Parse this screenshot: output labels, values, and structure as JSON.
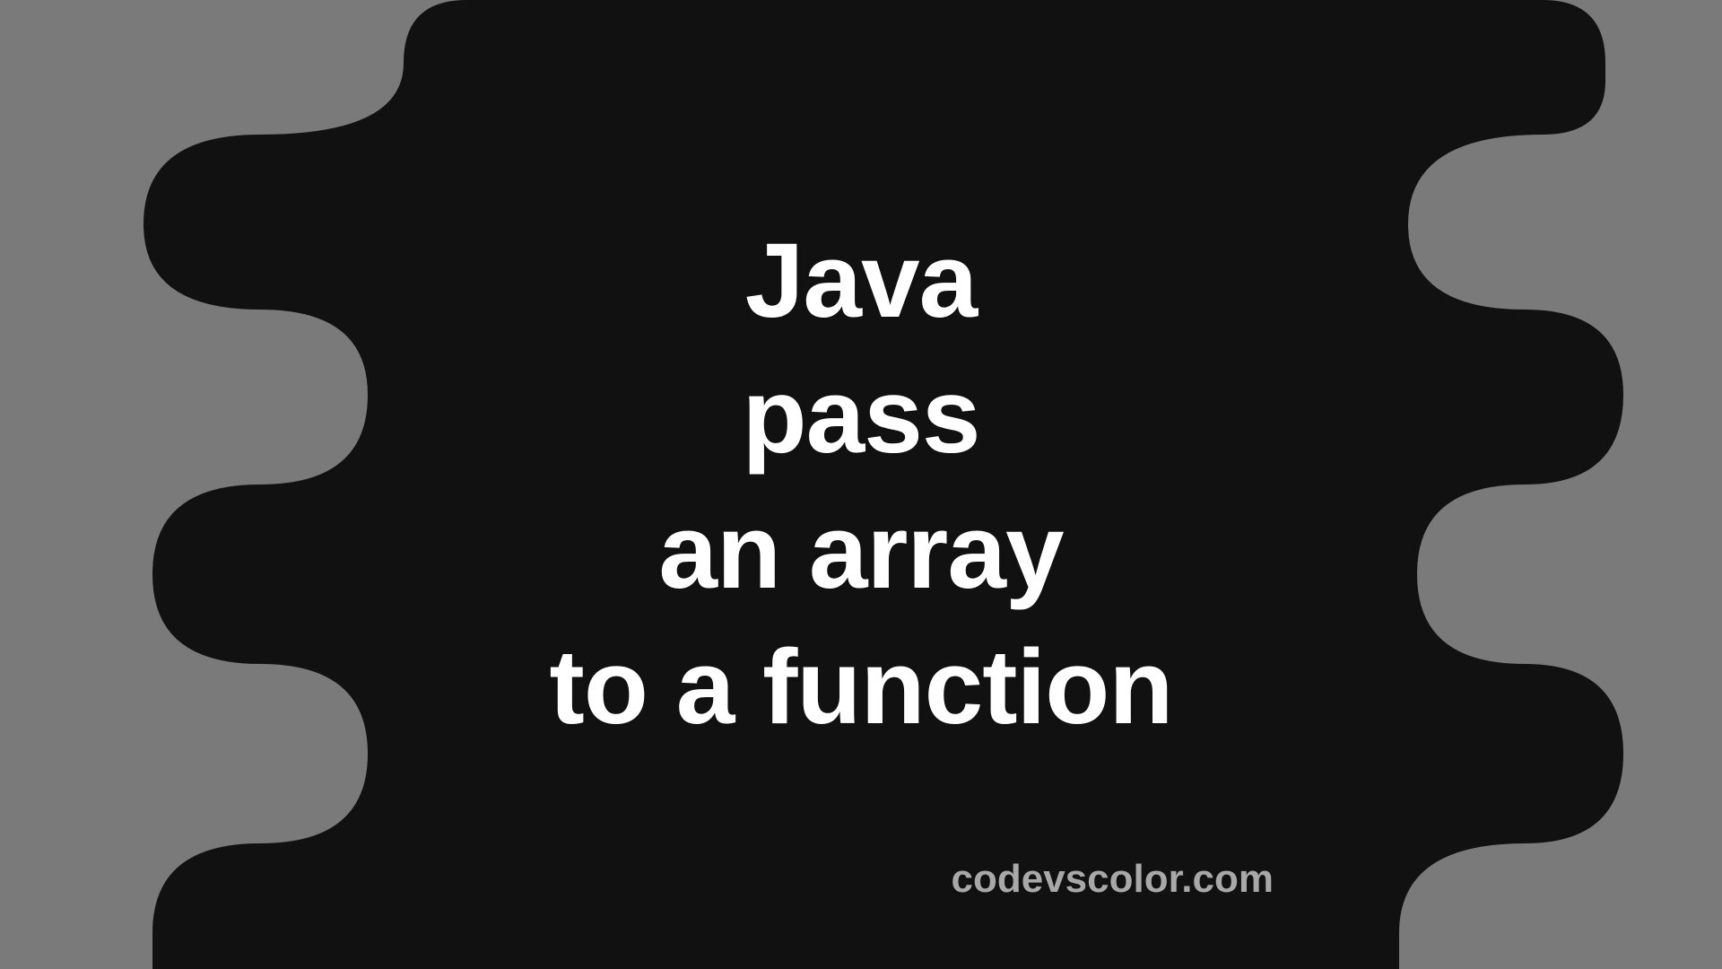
{
  "title": {
    "line1": "Java",
    "line2": "pass",
    "line3": "an array",
    "line4": "to a function"
  },
  "site_name": "codevscolor.com",
  "colors": {
    "background": "#7a7a7a",
    "blob": "#111111",
    "text": "#ffffff",
    "site_text": "#a8a8a8"
  }
}
